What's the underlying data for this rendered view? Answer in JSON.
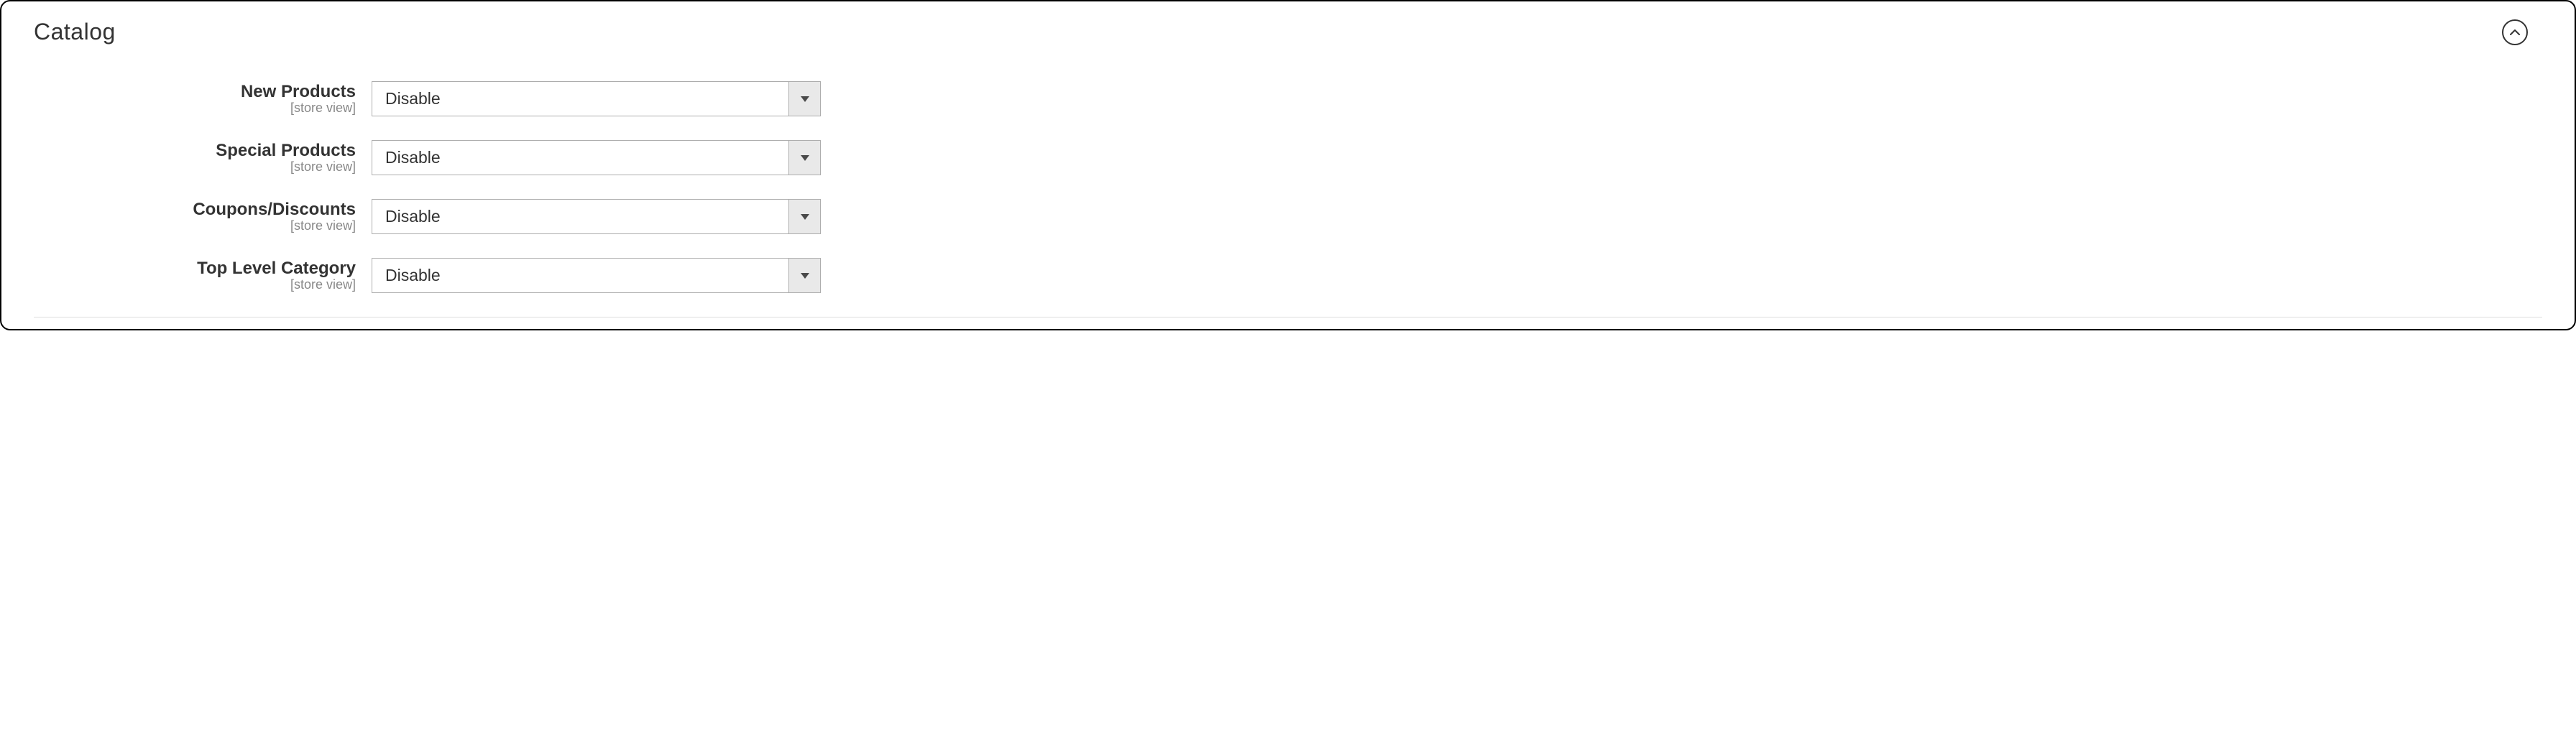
{
  "section": {
    "title": "Catalog",
    "scope_label": "[store view]",
    "fields": [
      {
        "label": "New Products",
        "value": "Disable"
      },
      {
        "label": "Special Products",
        "value": "Disable"
      },
      {
        "label": "Coupons/Discounts",
        "value": "Disable"
      },
      {
        "label": "Top Level Category",
        "value": "Disable"
      }
    ]
  }
}
